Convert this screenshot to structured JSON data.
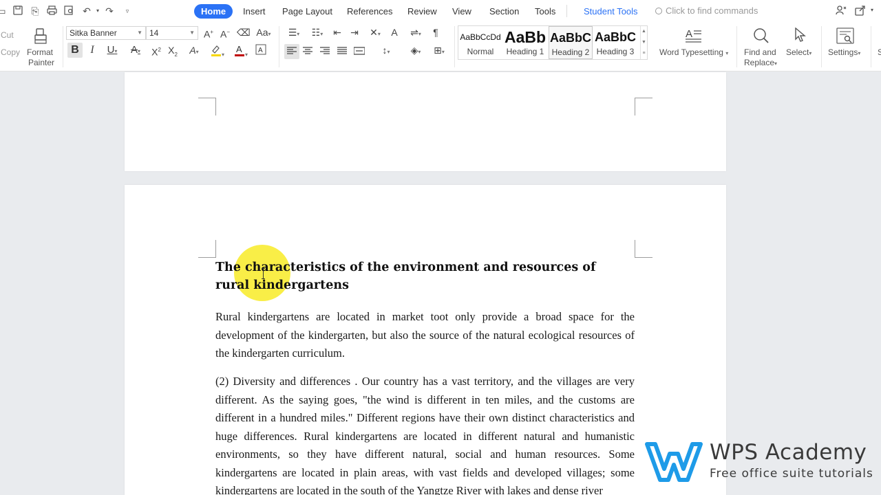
{
  "menubar": {
    "tabs": [
      {
        "label": "Home",
        "active": true
      },
      {
        "label": "Insert"
      },
      {
        "label": "Page Layout"
      },
      {
        "label": "References"
      },
      {
        "label": "Review"
      },
      {
        "label": "View"
      },
      {
        "label": "Section"
      },
      {
        "label": "Tools"
      }
    ],
    "student_tools": "Student Tools",
    "find_commands": "Click to find commands"
  },
  "ribbon": {
    "clipboard": {
      "cut": "Cut",
      "copy": "Copy",
      "format_painter_line1": "Format",
      "format_painter_line2": "Painter"
    },
    "font": {
      "name": "Sitka Banner",
      "size": "14"
    },
    "styles": [
      {
        "preview": "AaBbCcDd",
        "label": "Normal"
      },
      {
        "preview": "AaBb",
        "label": "Heading 1"
      },
      {
        "preview": "AaBbC",
        "label": "Heading 2",
        "selected": true
      },
      {
        "preview": "AaBbC",
        "label": "Heading 3"
      }
    ],
    "word_typesetting": "Word Typesetting",
    "find_replace_line1": "Find and",
    "find_replace_line2": "Replace",
    "select": "Select",
    "settings": "Settings"
  },
  "document": {
    "heading": "The characteristics of the environment and resources of rural kindergartens",
    "paragraphs": [
      "Rural kindergartens are located in market toot only provide a broad space for the development of the kindergarten, but also the source of the natural ecological resources of the kindergarten curriculum.",
      "(2) Diversity and differences . Our country has a vast territory, and the villages are very different. As the saying goes, \"the wind is different in ten miles, and the customs are different in a hundred miles.\" Different regions have their own distinct characteristics and huge differences. Rural kindergartens are located in different natural and humanistic environments, so they have different natural, social and human resources. Some kindergartens are located in plain areas, with vast fields and developed villages; some kindergartens are located in the south of the Yangtze River with lakes and dense river"
    ]
  },
  "watermark": {
    "title": "WPS Academy",
    "subtitle": "Free office suite tutorials"
  },
  "colors": {
    "accent": "#2b72f5",
    "highlight": "#f8ea1e",
    "logo_blue": "#1e9be8"
  }
}
